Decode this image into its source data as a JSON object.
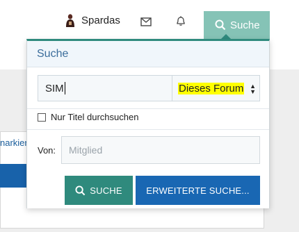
{
  "nav": {
    "username": "Spardas",
    "search_tab_label": "Suche"
  },
  "background": {
    "left_link_text": "narkier"
  },
  "search_panel": {
    "title": "Suche",
    "query_value": "SIM",
    "scope_selected": "Dieses Forum",
    "titles_only_label": "Nur Titel durchsuchen",
    "titles_only_checked": false,
    "by_label": "Von:",
    "member_placeholder": "Mitglied",
    "search_button_label": "SUCHE",
    "advanced_button_label": "ERWEITERTE SUCHE..."
  },
  "colors": {
    "accent_teal": "#2f8a7d",
    "search_tab": "#85c3b6",
    "advanced_blue": "#1967b3",
    "highlight": "#ffff00",
    "header_text": "#3b6d9b"
  },
  "icons": {
    "user": "avatar",
    "mail": "envelope-icon",
    "alerts": "bell-icon",
    "search": "search-icon"
  }
}
